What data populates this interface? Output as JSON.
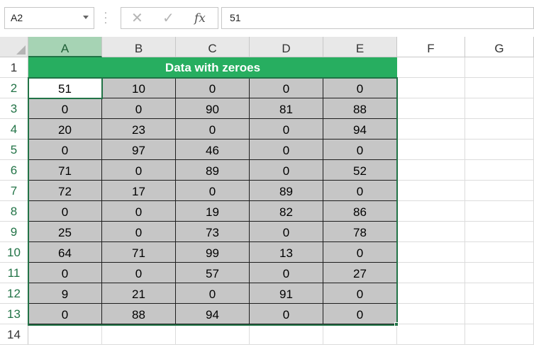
{
  "namebox": {
    "value": "A2"
  },
  "formula": {
    "cancel_icon": "✕",
    "enter_icon": "✓",
    "fx_label": "fx",
    "value": "51"
  },
  "columns": [
    "A",
    "B",
    "C",
    "D",
    "E",
    "F",
    "G"
  ],
  "rows": [
    "1",
    "2",
    "3",
    "4",
    "5",
    "6",
    "7",
    "8",
    "9",
    "10",
    "11",
    "12",
    "13",
    "14"
  ],
  "title": "Data with zeroes",
  "active_cell": "A2",
  "data": [
    [
      "51",
      "10",
      "0",
      "0",
      "0"
    ],
    [
      "0",
      "0",
      "90",
      "81",
      "88"
    ],
    [
      "20",
      "23",
      "0",
      "0",
      "94"
    ],
    [
      "0",
      "97",
      "46",
      "0",
      "0"
    ],
    [
      "71",
      "0",
      "89",
      "0",
      "52"
    ],
    [
      "72",
      "17",
      "0",
      "89",
      "0"
    ],
    [
      "0",
      "0",
      "19",
      "82",
      "86"
    ],
    [
      "25",
      "0",
      "73",
      "0",
      "78"
    ],
    [
      "64",
      "71",
      "99",
      "13",
      "0"
    ],
    [
      "0",
      "0",
      "57",
      "0",
      "27"
    ],
    [
      "9",
      "21",
      "0",
      "91",
      "0"
    ],
    [
      "0",
      "88",
      "94",
      "0",
      "0"
    ]
  ],
  "colors": {
    "title_bg": "#27ae60",
    "range_bg": "#c6c6c6",
    "selection": "#217346"
  }
}
